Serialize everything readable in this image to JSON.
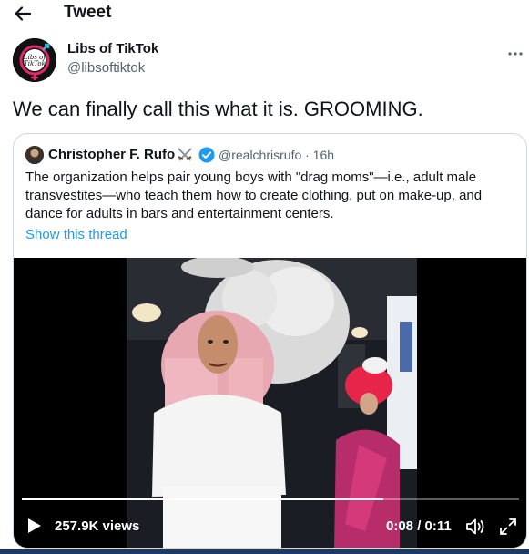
{
  "header": {
    "title": "Tweet",
    "back_icon": "arrow-left-icon"
  },
  "tweet": {
    "author_name": "Libs of TikTok",
    "author_handle": "@libsoftiktok",
    "avatar_logo_text": [
      "Libs of",
      "TikTok"
    ],
    "text": "We can finally call this what it is. GROOMING.",
    "more_icon": "ellipsis-icon"
  },
  "quoted_tweet": {
    "author_name": "Christopher F. Rufo",
    "author_emoji": "crossed-swords-icon",
    "verified_icon": "verified-badge-icon",
    "handle_time": "@realchrisrufo · 16h",
    "text": "The organization helps pair young boys with \"drag moms\"—i.e., adult male transvestites—who teach them how to create clothing, put on make-up, and dance for adults in bars and entertainment centers.",
    "thread_link": "Show this thread"
  },
  "video": {
    "views": "257.9K views",
    "time": "0:08 / 0:11",
    "progress": 0.727,
    "play_icon": "play-icon",
    "volume_icon": "volume-icon",
    "fullscreen_icon": "fullscreen-icon"
  },
  "colors": {
    "accent": "#1d9bf0",
    "text": "#0f1419",
    "secondary_text": "#536471",
    "border": "#cfd9de"
  }
}
